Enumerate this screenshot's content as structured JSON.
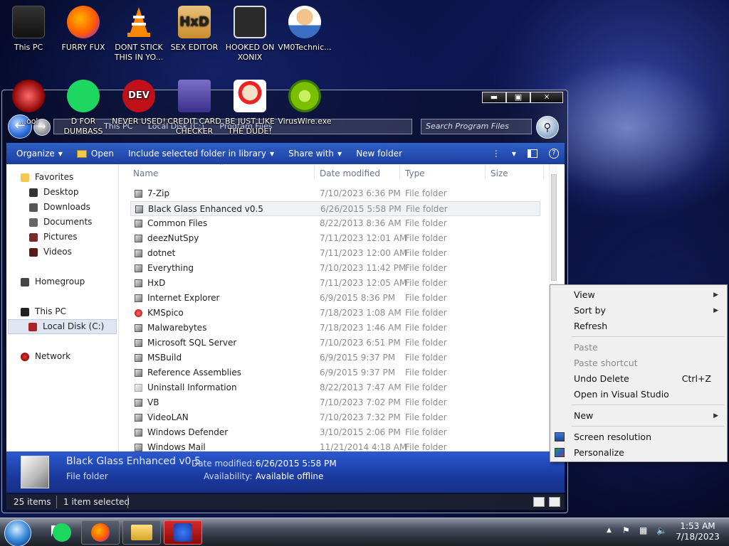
{
  "desktop": {
    "icons_row1": [
      {
        "label": "This PC"
      },
      {
        "label": "FURRY FUX"
      },
      {
        "label": "DONT STICK THIS IN YO..."
      },
      {
        "label": "SEX EDITOR"
      },
      {
        "label": "HOOKED ON XONIX"
      },
      {
        "label": "VM0Technic..."
      }
    ],
    "icons_row2": [
      {
        "label": "...ool"
      },
      {
        "label": "D FOR DUMBASS"
      },
      {
        "label": "NEVER USED!"
      },
      {
        "label": "CREDIT CARD CHECKER"
      },
      {
        "label": "BE JUST LIKE THE DUDE!"
      },
      {
        "label": "VirusWire.exe"
      }
    ],
    "dev_icon_text": "DEV",
    "hxd_icon_text": "HxD"
  },
  "explorer": {
    "address_parts": [
      "This PC",
      "Local Disk (C:)",
      "Program Files"
    ],
    "search_placeholder": "Search Program Files",
    "toolbar": {
      "organize": "Organize",
      "open": "Open",
      "include": "Include selected folder in library",
      "share": "Share with",
      "new_folder": "New folder"
    },
    "nav": {
      "favorites": "Favorites",
      "desktop": "Desktop",
      "downloads": "Downloads",
      "documents": "Documents",
      "pictures": "Pictures",
      "videos": "Videos",
      "homegroup": "Homegroup",
      "this_pc": "This PC",
      "local_disk": "Local Disk (C:)",
      "network": "Network"
    },
    "columns": {
      "name": "Name",
      "date": "Date modified",
      "type": "Type",
      "size": "Size"
    },
    "files": [
      {
        "name": "7-Zip",
        "date": "7/10/2023 6:36 PM",
        "type": "File folder"
      },
      {
        "name": "Black Glass Enhanced v0.5",
        "date": "6/26/2015 5:58 PM",
        "type": "File folder"
      },
      {
        "name": "Common Files",
        "date": "8/22/2013 8:36 AM",
        "type": "File folder"
      },
      {
        "name": "deezNutSpy",
        "date": "7/11/2023 12:01 AM",
        "type": "File folder"
      },
      {
        "name": "dotnet",
        "date": "7/11/2023 12:00 AM",
        "type": "File folder"
      },
      {
        "name": "Everything",
        "date": "7/10/2023 11:42 PM",
        "type": "File folder"
      },
      {
        "name": "HxD",
        "date": "7/11/2023 12:05 AM",
        "type": "File folder"
      },
      {
        "name": "Internet Explorer",
        "date": "6/9/2015 8:36 PM",
        "type": "File folder"
      },
      {
        "name": "KMSpico",
        "date": "7/18/2023 1:08 AM",
        "type": "File folder"
      },
      {
        "name": "Malwarebytes",
        "date": "7/18/2023 1:46 AM",
        "type": "File folder"
      },
      {
        "name": "Microsoft SQL Server",
        "date": "7/10/2023 6:51 PM",
        "type": "File folder"
      },
      {
        "name": "MSBuild",
        "date": "6/9/2015 9:37 PM",
        "type": "File folder"
      },
      {
        "name": "Reference Assemblies",
        "date": "6/9/2015 9:37 PM",
        "type": "File folder"
      },
      {
        "name": "Uninstall Information",
        "date": "8/22/2013 7:47 AM",
        "type": "File folder"
      },
      {
        "name": "VB",
        "date": "7/10/2023 7:02 PM",
        "type": "File folder"
      },
      {
        "name": "VideoLAN",
        "date": "7/10/2023 7:32 PM",
        "type": "File folder"
      },
      {
        "name": "Windows Defender",
        "date": "3/10/2015 2:06 PM",
        "type": "File folder"
      },
      {
        "name": "Windows Mail",
        "date": "11/21/2014 4:18 AM",
        "type": "File folder"
      }
    ],
    "details": {
      "name": "Black Glass Enhanced v0.5",
      "type": "File folder",
      "date_label": "Date modified:",
      "date_value": "6/26/2015 5:58 PM",
      "avail_label": "Availability:",
      "avail_value": "Available offline"
    },
    "status": {
      "count": "25 items",
      "selected": "1 item selected"
    }
  },
  "context_menu": {
    "view": "View",
    "sort_by": "Sort by",
    "refresh": "Refresh",
    "paste": "Paste",
    "paste_shortcut": "Paste shortcut",
    "undo_delete": "Undo Delete",
    "undo_shortcut": "Ctrl+Z",
    "open_vs": "Open in Visual Studio",
    "new": "New",
    "screen_resolution": "Screen resolution",
    "personalize": "Personalize"
  },
  "taskbar": {
    "time": "1:53 AM",
    "date": "7/18/2023"
  }
}
